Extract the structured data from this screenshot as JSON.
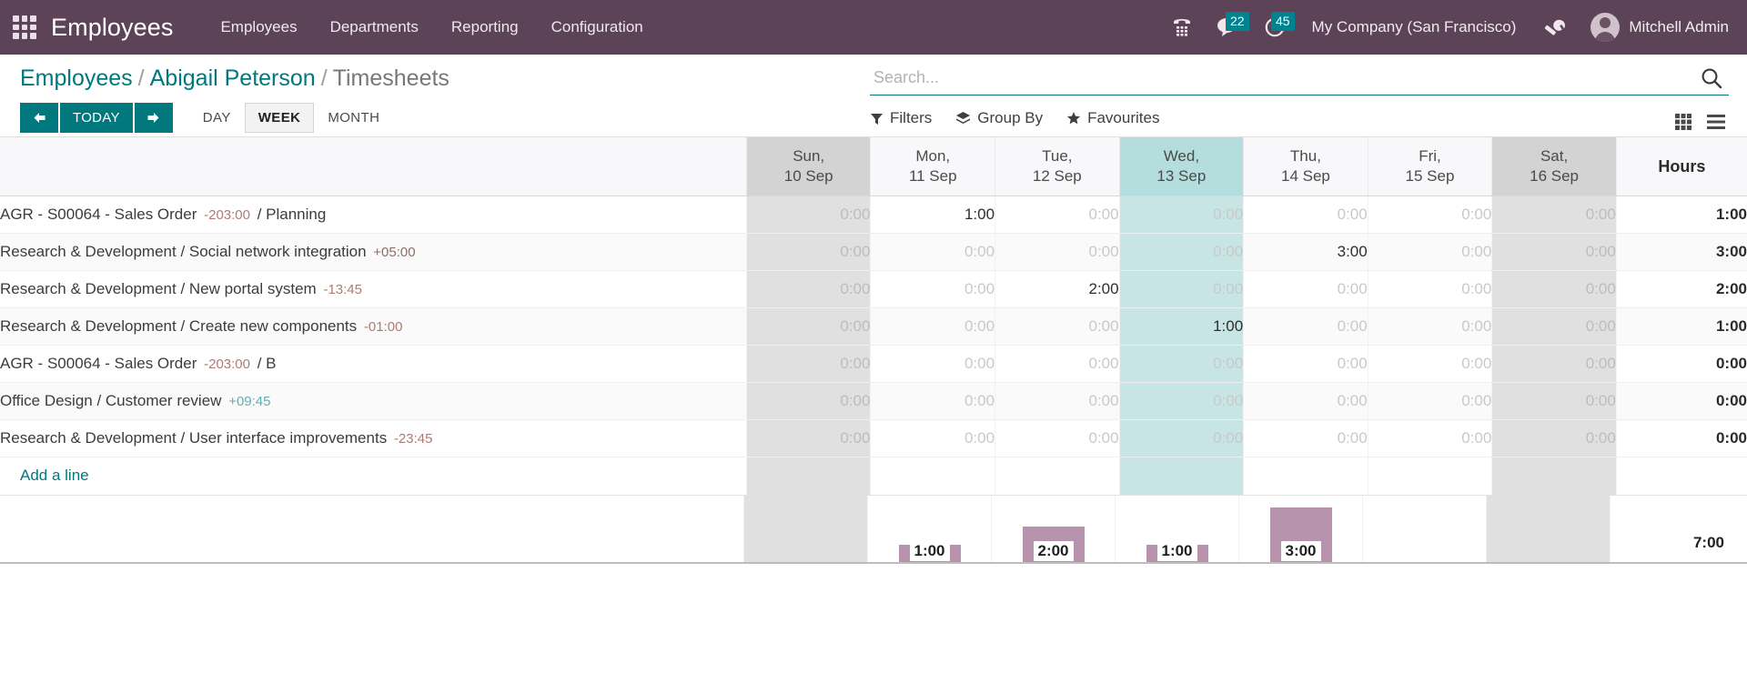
{
  "navbar": {
    "apps_icon": "apps-grid-icon",
    "brand": "Employees",
    "menus": [
      {
        "label": "Employees"
      },
      {
        "label": "Departments"
      },
      {
        "label": "Reporting"
      },
      {
        "label": "Configuration"
      }
    ],
    "icons": {
      "phone": "phone-dialpad-icon",
      "messages": "chat-bubble-icon",
      "activities": "clock-icon"
    },
    "message_count": "22",
    "activity_count": "45",
    "company": "My Company (San Francisco)",
    "debug_icon": "wrench-icon",
    "user_name": "Mitchell Admin",
    "accent_bg": "#5d4357",
    "badge_bg": "#00838f"
  },
  "breadcrumb": {
    "root": "Employees",
    "employee": "Abigail Peterson",
    "current": "Timesheets",
    "separator": "/"
  },
  "controls": {
    "prev_icon": "arrow-left-icon",
    "today_label": "TODAY",
    "next_icon": "arrow-right-icon",
    "scales": [
      {
        "label": "DAY",
        "active": false
      },
      {
        "label": "WEEK",
        "active": true
      },
      {
        "label": "MONTH",
        "active": false
      }
    ],
    "accent": "#00787d"
  },
  "search": {
    "placeholder": "Search...",
    "value": "",
    "search_icon": "search-icon"
  },
  "filters": [
    {
      "label": "Filters",
      "icon": "funnel-icon"
    },
    {
      "label": "Group By",
      "icon": "layers-icon"
    },
    {
      "label": "Favourites",
      "icon": "star-icon"
    }
  ],
  "view_switcher": [
    {
      "name": "grid-view",
      "icon": "grid-view-icon",
      "active": true
    },
    {
      "name": "list-view",
      "icon": "list-view-icon",
      "active": false
    }
  ],
  "grid": {
    "label_header": "",
    "hours_header": "Hours",
    "columns": [
      {
        "day": "Sun,",
        "date": "10 Sep",
        "weekend": true,
        "today": false
      },
      {
        "day": "Mon,",
        "date": "11 Sep",
        "weekend": false,
        "today": false
      },
      {
        "day": "Tue,",
        "date": "12 Sep",
        "weekend": false,
        "today": false
      },
      {
        "day": "Wed,",
        "date": "13 Sep",
        "weekend": false,
        "today": true
      },
      {
        "day": "Thu,",
        "date": "14 Sep",
        "weekend": false,
        "today": false
      },
      {
        "day": "Fri,",
        "date": "15 Sep",
        "weekend": false,
        "today": false
      },
      {
        "day": "Sat,",
        "date": "16 Sep",
        "weekend": true,
        "today": false
      }
    ],
    "rows": [
      {
        "project": "AGR - S00064 - Sales Order",
        "delta": "-203:00",
        "delta_kind": "neg",
        "task": "Planning",
        "values": [
          "0:00",
          "1:00",
          "0:00",
          "0:00",
          "0:00",
          "0:00",
          "0:00"
        ],
        "total": "1:00"
      },
      {
        "project": "Research & Development",
        "delta": "+05:00",
        "delta_kind": "pos",
        "task": "Social network integration",
        "delta_after_task": true,
        "values": [
          "0:00",
          "0:00",
          "0:00",
          "0:00",
          "3:00",
          "0:00",
          "0:00"
        ],
        "total": "3:00"
      },
      {
        "project": "Research & Development",
        "delta": "-13:45",
        "delta_kind": "neg",
        "task": "New portal system",
        "delta_after_task": true,
        "values": [
          "0:00",
          "0:00",
          "2:00",
          "0:00",
          "0:00",
          "0:00",
          "0:00"
        ],
        "total": "2:00"
      },
      {
        "project": "Research & Development",
        "delta": "-01:00",
        "delta_kind": "neg",
        "task": "Create new components",
        "delta_after_task": true,
        "values": [
          "0:00",
          "0:00",
          "0:00",
          "1:00",
          "0:00",
          "0:00",
          "0:00"
        ],
        "total": "1:00"
      },
      {
        "project": "AGR - S00064 - Sales Order",
        "delta": "-203:00",
        "delta_kind": "neg",
        "task": "B",
        "values": [
          "0:00",
          "0:00",
          "0:00",
          "0:00",
          "0:00",
          "0:00",
          "0:00"
        ],
        "total": "0:00"
      },
      {
        "project": "Office Design",
        "delta": "+09:45",
        "delta_kind": "pos-teal",
        "task": "Customer review",
        "delta_after_task": true,
        "values": [
          "0:00",
          "0:00",
          "0:00",
          "0:00",
          "0:00",
          "0:00",
          "0:00"
        ],
        "total": "0:00"
      },
      {
        "project": "Research & Development",
        "delta": "-23:45",
        "delta_kind": "neg",
        "task": "User interface improvements",
        "delta_after_task": true,
        "values": [
          "0:00",
          "0:00",
          "0:00",
          "0:00",
          "0:00",
          "0:00",
          "0:00"
        ],
        "total": "0:00"
      }
    ],
    "add_line_label": "Add a line"
  },
  "chart_data": {
    "type": "bar",
    "title": "Daily timesheet totals",
    "categories": [
      "Sun, 10 Sep",
      "Mon, 11 Sep",
      "Tue, 12 Sep",
      "Wed, 13 Sep",
      "Thu, 14 Sep",
      "Fri, 15 Sep",
      "Sat, 16 Sep"
    ],
    "values": [
      0,
      1,
      2,
      1,
      3,
      0,
      0
    ],
    "labels": [
      "",
      "1:00",
      "2:00",
      "1:00",
      "3:00",
      "",
      ""
    ],
    "ylabel": "Hours",
    "ylim": [
      0,
      3
    ],
    "bar_color": "#b793ad",
    "grand_total": "7:00"
  }
}
